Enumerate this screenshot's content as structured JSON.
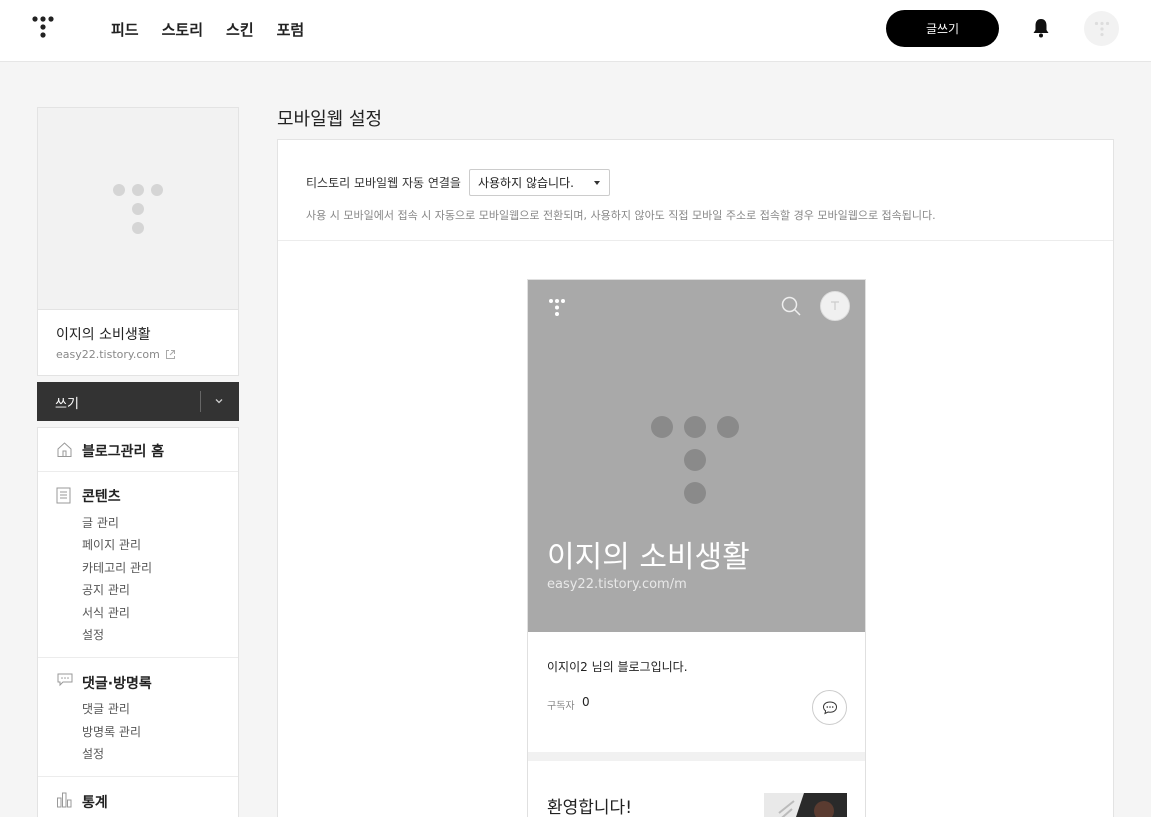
{
  "nav": [
    "피드",
    "스토리",
    "스킨",
    "포럼"
  ],
  "header": {
    "write_label": "글쓰기"
  },
  "sidebar": {
    "blog_name": "이지의 소비생활",
    "blog_url": "easy22.tistory.com",
    "write_label": "쓰기",
    "home_label": "블로그관리 홈",
    "content": {
      "title": "콘텐츠",
      "items": [
        "글 관리",
        "페이지 관리",
        "카테고리 관리",
        "공지 관리",
        "서식 관리",
        "설정"
      ]
    },
    "comments": {
      "title": "댓글·방명록",
      "items": [
        "댓글 관리",
        "방명록 관리",
        "설정"
      ]
    },
    "stats": {
      "title": "통계"
    }
  },
  "main": {
    "title": "모바일웹 설정",
    "setting_label": "티스토리 모바일웹 자동 연결을",
    "select_value": "사용하지 않습니다.",
    "help_text": "사용 시 모바일에서 접속 시 자동으로 모바일웹으로 전환되며, 사용하지 않아도 직접 모바일 주소로 접속할 경우 모바일웹으로 접속됩니다."
  },
  "preview": {
    "blog_title": "이지의 소비생활",
    "blog_url": "easy22.tistory.com/m",
    "intro": "이지이2 님의 블로그입니다.",
    "subscribers_label": "구독자",
    "subscribers_count": "0",
    "post_title": "환영합니다!"
  },
  "colors": {
    "header_bg": "#ffffff",
    "write_button": "#000000",
    "hero_bg": "#a9a9a9",
    "page_bg": "#f5f5f5"
  }
}
